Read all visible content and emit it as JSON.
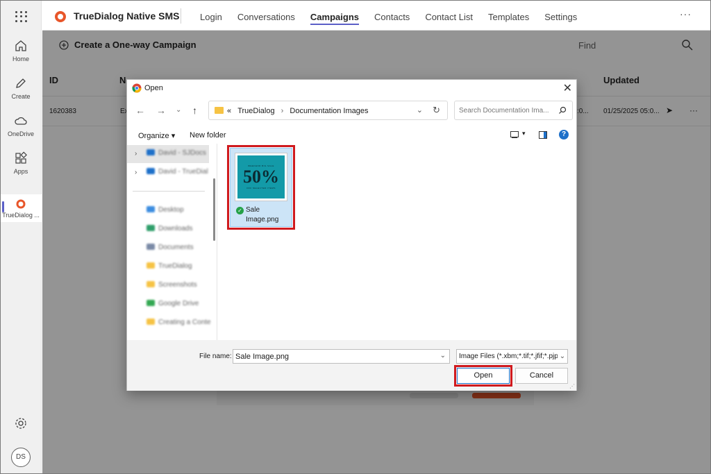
{
  "rail": {
    "items": [
      {
        "label": "Home",
        "icon": "home-icon"
      },
      {
        "label": "Create",
        "icon": "pen-icon"
      },
      {
        "label": "OneDrive",
        "icon": "cloud-icon"
      },
      {
        "label": "Apps",
        "icon": "apps-icon"
      },
      {
        "label": "TrueDialog ...",
        "icon": "truedialog-icon"
      }
    ],
    "avatar_initials": "DS"
  },
  "app": {
    "title": "TrueDialog Native SMS",
    "brand_color": "#e8562a",
    "accent_color": "#5b5fc7",
    "nav": [
      "Login",
      "Conversations",
      "Campaigns",
      "Contacts",
      "Contact List",
      "Templates",
      "Settings"
    ],
    "active_nav": "Campaigns",
    "more_label": "···"
  },
  "toolbar": {
    "create_label": "Create a One-way Campaign",
    "find_label": "Find"
  },
  "table": {
    "headers": {
      "id": "ID",
      "n": "N",
      "updated": "Updated"
    },
    "row": {
      "id": "1620383",
      "name_fragment": "Ex",
      "mid_fragment": ":0...",
      "updated": "01/25/2025 05:0...",
      "more": "···"
    }
  },
  "dialog": {
    "title": "Open",
    "close": "✕",
    "breadcrumb": [
      "«",
      "TrueDialog",
      "Documentation Images"
    ],
    "search_placeholder": "Search Documentation Ima...",
    "organize_label": "Organize ▾",
    "new_folder_label": "New folder",
    "help_label": "?",
    "nav_items": [
      {
        "label": "David - SJDocs",
        "color": "#1e70c9"
      },
      {
        "label": "David - TrueDial",
        "color": "#1e70c9"
      },
      {
        "label": "Desktop",
        "color": "#3c8de0"
      },
      {
        "label": "Downloads",
        "color": "#2f9e6a"
      },
      {
        "label": "Documents",
        "color": "#7a8aa6"
      },
      {
        "label": "TrueDialog",
        "color": "#f6c344"
      },
      {
        "label": "Screenshots",
        "color": "#f6c344"
      },
      {
        "label": "Google Drive",
        "color": "#34a853"
      },
      {
        "label": "Creating a Conte",
        "color": "#f6c344"
      }
    ],
    "file": {
      "name_line1": "Sale",
      "name_line2": "Image.png",
      "thumb_top": "WEEKEND BIG SALE",
      "thumb_big": "50%",
      "thumb_bottom": "OFF SELECTED ITEMS"
    },
    "file_name_label": "File name:",
    "file_name_value": "Sale Image.png",
    "file_type_value": "Image Files (*.xbm;*.tif;*.jfif;*.pjp",
    "open_label": "Open",
    "cancel_label": "Cancel",
    "highlight_color": "#d01a1e"
  }
}
